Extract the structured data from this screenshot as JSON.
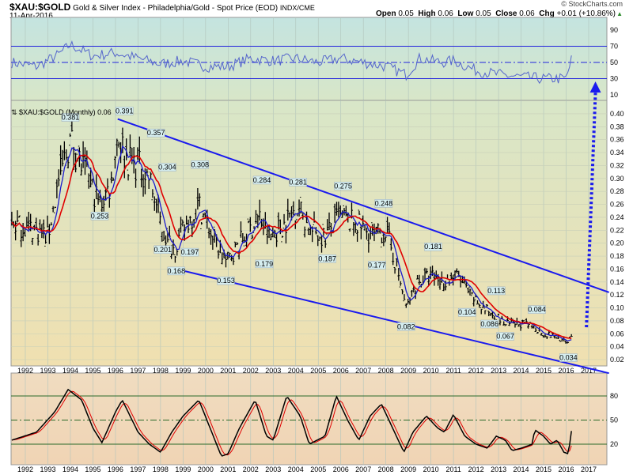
{
  "header": {
    "symbol": "$XAU:$GOLD",
    "description": "Gold & Silver Index - Philadelphia/Gold - Spot Price (EOD)",
    "exchange": "INDX/CME",
    "date": "11-Apr-2016",
    "copyright": "© StockCharts.com",
    "quote": {
      "open_label": "Open",
      "open": "0.05",
      "high_label": "High",
      "high": "0.06",
      "low_label": "Low",
      "low": "0.05",
      "close_label": "Close",
      "close": "0.06",
      "chg_label": "Chg",
      "chg": "+0.01 (+10.86%)"
    }
  },
  "legend": "$XAU:$GOLD (Monthly) 0.06",
  "chart_data": [
    {
      "type": "line",
      "name": "rsi-panel",
      "yticks": [
        90,
        70,
        50,
        30,
        10
      ],
      "hlines": [
        70,
        50,
        30
      ],
      "points": [
        [
          1991.4,
          50
        ],
        [
          1992.5,
          45
        ],
        [
          1993.5,
          60
        ],
        [
          1994,
          72
        ],
        [
          1995,
          58
        ],
        [
          1996,
          62
        ],
        [
          1997,
          55
        ],
        [
          1998,
          48
        ],
        [
          1999,
          52
        ],
        [
          2000,
          45
        ],
        [
          2001,
          45
        ],
        [
          2002,
          55
        ],
        [
          2003,
          52
        ],
        [
          2004,
          55
        ],
        [
          2005,
          50
        ],
        [
          2006,
          55
        ],
        [
          2007,
          50
        ],
        [
          2008,
          45
        ],
        [
          2008.9,
          35
        ],
        [
          2009.5,
          55
        ],
        [
          2010.5,
          50
        ],
        [
          2011,
          52
        ],
        [
          2012,
          40
        ],
        [
          2013,
          35
        ],
        [
          2014,
          32
        ],
        [
          2015,
          30
        ],
        [
          2016,
          30
        ],
        [
          2016.25,
          55
        ]
      ],
      "color": "#5566cc"
    },
    {
      "type": "ohlc",
      "name": "price-panel",
      "title": "$XAU:$GOLD (Monthly)",
      "ylim": [
        0.02,
        0.4
      ],
      "yticks": [
        "0.40",
        "0.38",
        "0.36",
        "0.34",
        "0.32",
        "0.30",
        "0.28",
        "0.26",
        "0.24",
        "0.22",
        "0.20",
        "0.18",
        "0.16",
        "0.14",
        "0.12",
        "0.10",
        "0.08",
        "0.06",
        "0.04",
        "0.02"
      ],
      "xticks": [
        "1992",
        "1993",
        "1994",
        "1995",
        "1996",
        "1997",
        "1998",
        "1999",
        "2000",
        "2001",
        "2002",
        "2003",
        "2004",
        "2005",
        "2006",
        "2007",
        "2008",
        "2009",
        "2010",
        "2011",
        "2012",
        "2013",
        "2014",
        "2015",
        "2016",
        "2017"
      ],
      "close_path": [
        [
          1991.4,
          0.23
        ],
        [
          1992.5,
          0.22
        ],
        [
          1993,
          0.21
        ],
        [
          1993.5,
          0.3
        ],
        [
          1994,
          0.36
        ],
        [
          1994.5,
          0.32
        ],
        [
          1995.3,
          0.26
        ],
        [
          1995.8,
          0.29
        ],
        [
          1996.1,
          0.37
        ],
        [
          1996.5,
          0.33
        ],
        [
          1997,
          0.32
        ],
        [
          1997.5,
          0.3
        ],
        [
          1998.1,
          0.22
        ],
        [
          1998.6,
          0.19
        ],
        [
          1999,
          0.22
        ],
        [
          1999.7,
          0.26
        ],
        [
          2000.3,
          0.21
        ],
        [
          2000.9,
          0.17
        ],
        [
          2001.5,
          0.2
        ],
        [
          2002.4,
          0.24
        ],
        [
          2002.8,
          0.21
        ],
        [
          2003.5,
          0.23
        ],
        [
          2004.1,
          0.26
        ],
        [
          2004.6,
          0.22
        ],
        [
          2005.3,
          0.21
        ],
        [
          2005.9,
          0.24
        ],
        [
          2006.7,
          0.23
        ],
        [
          2007.5,
          0.21
        ],
        [
          2008,
          0.22
        ],
        [
          2008.5,
          0.16
        ],
        [
          2008.9,
          0.1
        ],
        [
          2009.4,
          0.14
        ],
        [
          2010,
          0.15
        ],
        [
          2010.6,
          0.14
        ],
        [
          2011.2,
          0.15
        ],
        [
          2011.7,
          0.12
        ],
        [
          2012.3,
          0.1
        ],
        [
          2012.8,
          0.09
        ],
        [
          2013.3,
          0.075
        ],
        [
          2014,
          0.075
        ],
        [
          2014.6,
          0.07
        ],
        [
          2015,
          0.06
        ],
        [
          2015.6,
          0.055
        ],
        [
          2016,
          0.045
        ],
        [
          2016.25,
          0.06
        ]
      ],
      "annotations": [
        {
          "label": "0.381",
          "x": 1994.0,
          "y": 0.381,
          "pos": "above"
        },
        {
          "label": "0.253",
          "x": 1995.3,
          "y": 0.253,
          "pos": "below"
        },
        {
          "label": "0.391",
          "x": 1996.4,
          "y": 0.391,
          "pos": "above"
        },
        {
          "label": "0.357",
          "x": 1997.8,
          "y": 0.357,
          "pos": "above"
        },
        {
          "label": "0.304",
          "x": 1998.3,
          "y": 0.304,
          "pos": "above"
        },
        {
          "label": "0.201",
          "x": 1998.1,
          "y": 0.201,
          "pos": "below"
        },
        {
          "label": "0.168",
          "x": 1998.7,
          "y": 0.168,
          "pos": "below"
        },
        {
          "label": "0.308",
          "x": 1999.75,
          "y": 0.308,
          "pos": "above"
        },
        {
          "label": "0.197",
          "x": 1999.3,
          "y": 0.197,
          "pos": "below"
        },
        {
          "label": "0.153",
          "x": 2000.9,
          "y": 0.153,
          "pos": "below"
        },
        {
          "label": "0.284",
          "x": 2002.5,
          "y": 0.284,
          "pos": "above"
        },
        {
          "label": "0.179",
          "x": 2002.6,
          "y": 0.179,
          "pos": "below"
        },
        {
          "label": "0.281",
          "x": 2004.1,
          "y": 0.281,
          "pos": "above"
        },
        {
          "label": "0.187",
          "x": 2005.4,
          "y": 0.187,
          "pos": "below"
        },
        {
          "label": "0.275",
          "x": 2006.1,
          "y": 0.275,
          "pos": "above"
        },
        {
          "label": "0.248",
          "x": 2007.9,
          "y": 0.248,
          "pos": "above"
        },
        {
          "label": "0.177",
          "x": 2007.6,
          "y": 0.177,
          "pos": "below"
        },
        {
          "label": "0.082",
          "x": 2008.9,
          "y": 0.082,
          "pos": "below"
        },
        {
          "label": "0.181",
          "x": 2010.1,
          "y": 0.181,
          "pos": "above"
        },
        {
          "label": "0.104",
          "x": 2011.6,
          "y": 0.104,
          "pos": "below"
        },
        {
          "label": "0.113",
          "x": 2012.9,
          "y": 0.113,
          "pos": "above"
        },
        {
          "label": "0.086",
          "x": 2012.6,
          "y": 0.086,
          "pos": "below"
        },
        {
          "label": "0.067",
          "x": 2013.3,
          "y": 0.067,
          "pos": "below"
        },
        {
          "label": "0.084",
          "x": 2014.7,
          "y": 0.084,
          "pos": "above"
        },
        {
          "label": "0.034",
          "x": 2016.1,
          "y": 0.034,
          "pos": "below"
        }
      ],
      "trendlines": [
        {
          "from": [
            1996.1,
            0.392
          ],
          "to": [
            2017.9,
            0.124
          ],
          "color": "#1a1aee"
        },
        {
          "from": [
            1998.7,
            0.16
          ],
          "to": [
            2017.9,
            -0.001
          ],
          "color": "#1a1aee"
        }
      ],
      "arrow": {
        "from": [
          2016.9,
          0.07
        ],
        "to": [
          2017.3,
          0.445
        ],
        "color": "#1a1aee",
        "style": "dotted"
      },
      "ma_colors": {
        "fast": "#1a1acc",
        "slow": "#e00000"
      }
    },
    {
      "type": "line",
      "name": "stochastic-panel",
      "yticks": [
        80,
        50,
        20
      ],
      "hlines": [
        80,
        50,
        20
      ],
      "points": [
        [
          1991.4,
          25
        ],
        [
          1992.5,
          35
        ],
        [
          1993.3,
          60
        ],
        [
          1993.9,
          88
        ],
        [
          1994.5,
          75
        ],
        [
          1995,
          40
        ],
        [
          1995.4,
          22
        ],
        [
          1996,
          60
        ],
        [
          1996.3,
          75
        ],
        [
          1997,
          35
        ],
        [
          1997.5,
          20
        ],
        [
          1998,
          10
        ],
        [
          1998.5,
          35
        ],
        [
          1999,
          55
        ],
        [
          1999.7,
          75
        ],
        [
          2000.2,
          40
        ],
        [
          2000.7,
          5
        ],
        [
          2001,
          8
        ],
        [
          2001.5,
          40
        ],
        [
          2002.2,
          75
        ],
        [
          2002.7,
          30
        ],
        [
          2003,
          25
        ],
        [
          2003.6,
          80
        ],
        [
          2004.2,
          55
        ],
        [
          2004.6,
          20
        ],
        [
          2005.3,
          30
        ],
        [
          2005.8,
          80
        ],
        [
          2006.3,
          50
        ],
        [
          2006.8,
          25
        ],
        [
          2007.3,
          55
        ],
        [
          2007.8,
          70
        ],
        [
          2008.3,
          40
        ],
        [
          2008.8,
          10
        ],
        [
          2009.2,
          35
        ],
        [
          2009.8,
          55
        ],
        [
          2010.3,
          40
        ],
        [
          2010.6,
          35
        ],
        [
          2011,
          57
        ],
        [
          2011.5,
          30
        ],
        [
          2012,
          20
        ],
        [
          2012.5,
          15
        ],
        [
          2012.9,
          30
        ],
        [
          2013.3,
          25
        ],
        [
          2013.6,
          12
        ],
        [
          2014,
          15
        ],
        [
          2014.5,
          20
        ],
        [
          2014.6,
          38
        ],
        [
          2015,
          30
        ],
        [
          2015.3,
          20
        ],
        [
          2015.6,
          25
        ],
        [
          2015.9,
          10
        ],
        [
          2016.1,
          8
        ],
        [
          2016.25,
          40
        ]
      ],
      "colors": {
        "fast": "#000000",
        "signal": "#e00000"
      }
    }
  ]
}
